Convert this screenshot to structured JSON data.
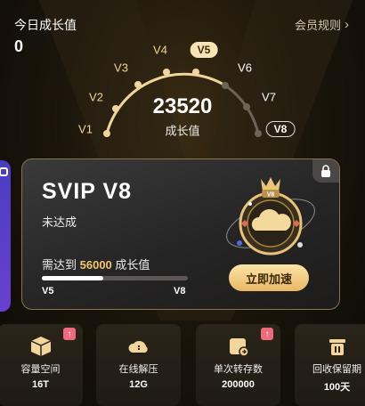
{
  "header": {
    "today_label": "今日成长值",
    "today_value": "0",
    "rules_label": "会员规则",
    "rules_chevron": "›"
  },
  "gauge": {
    "levels": [
      "V1",
      "V2",
      "V3",
      "V4",
      "V5",
      "V6",
      "V7",
      "V8"
    ],
    "current_level": "V5",
    "target_level": "V8",
    "value": "23520",
    "value_label": "成长值"
  },
  "card": {
    "title": "SVIP V8",
    "status": "未达成",
    "need_prefix": "需达到",
    "need_value": "56000",
    "need_suffix": "成长值",
    "progress": 0.42,
    "from_level": "V5",
    "to_level": "V8",
    "badge_label": "V8",
    "boost_button": "立即加速",
    "icons": [
      "lock-icon",
      "cloud-badge-icon",
      "crown-icon"
    ]
  },
  "benefits": [
    {
      "label": "容量空间",
      "value": "16T",
      "icon": "box-icon",
      "upgrade": true
    },
    {
      "label": "在线解压",
      "value": "12G",
      "icon": "unzip-icon",
      "upgrade": false
    },
    {
      "label": "单次转存数",
      "value": "200000",
      "icon": "transfer-icon",
      "upgrade": true
    },
    {
      "label": "回收保留期",
      "value": "100天",
      "icon": "trash-icon",
      "upgrade": false
    }
  ],
  "upgrade_glyph": "↑",
  "colors": {
    "accent": "#f7e3b3",
    "highlight": "#f2c66b",
    "upgrade": "#f06a7e"
  }
}
